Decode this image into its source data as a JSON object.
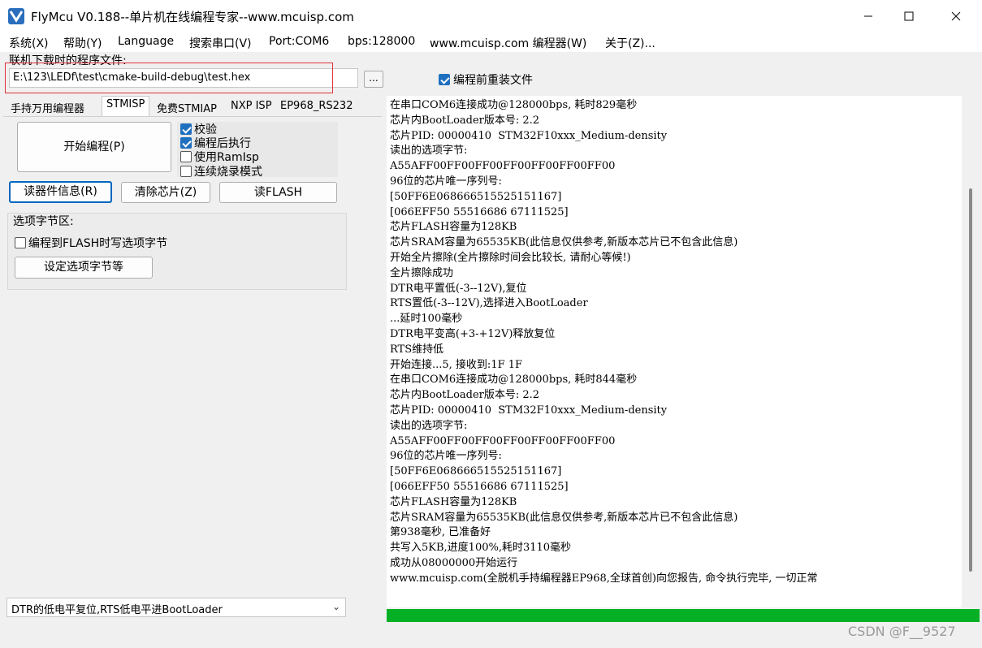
{
  "window": {
    "title": "FlyMcu V0.188--单片机在线编程专家--www.mcuisp.com"
  },
  "menu": [
    "系统(X)",
    "帮助(Y)",
    "Language",
    "搜索串口(V)",
    "Port:COM6",
    "bps:128000",
    "www.mcuisp.com 编程器(W)",
    "关于(Z)..."
  ],
  "file": {
    "label": "联机下载时的程序文件:",
    "path": "E:\\123\\LEDf\\test\\cmake-build-debug\\test.hex",
    "browse_label": "...",
    "reload_label": "编程前重装文件",
    "reload_checked": true
  },
  "tabs": [
    "手持万用编程器",
    "STMISP",
    "免费STMIAP",
    "NXP ISP",
    "EP968_RS232"
  ],
  "actions": {
    "start": "开始编程(P)",
    "read_info": "读器件信息(R)",
    "erase": "清除芯片(Z)",
    "read_flash": "读FLASH"
  },
  "options": [
    {
      "label": "校验",
      "checked": true
    },
    {
      "label": "编程后执行",
      "checked": true
    },
    {
      "label": "使用RamIsp",
      "checked": false
    },
    {
      "label": "连续烧录模式",
      "checked": false
    }
  ],
  "option_bytes": {
    "title": "选项字节区:",
    "write_label": "编程到FLASH时写选项字节",
    "write_checked": false,
    "set_button": "设定选项字节等"
  },
  "boot_mode": "DTR的低电平复位,RTS低电平进BootLoader",
  "log": [
    "在串口COM6连接成功@128000bps, 耗时829毫秒",
    "芯片内BootLoader版本号: 2.2",
    "芯片PID: 00000410  STM32F10xxx_Medium-density",
    "读出的选项字节:",
    "A55AFF00FF00FF00FF00FF00FF00FF00",
    "96位的芯片唯一序列号:",
    "[50FF6E068666515525151167]",
    "[066EFF50 55516686 67111525]",
    "芯片FLASH容量为128KB",
    "芯片SRAM容量为65535KB(此信息仅供参考,新版本芯片已不包含此信息)",
    "开始全片擦除(全片擦除时间会比较长, 请耐心等候!)",
    "全片擦除成功",
    "DTR电平置低(-3--12V),复位",
    "RTS置低(-3--12V),选择进入BootLoader",
    "...延时100毫秒",
    "DTR电平变高(+3-+12V)释放复位",
    "RTS维持低",
    "开始连接...5, 接收到:1F 1F",
    "在串口COM6连接成功@128000bps, 耗时844毫秒",
    "芯片内BootLoader版本号: 2.2",
    "芯片PID: 00000410  STM32F10xxx_Medium-density",
    "读出的选项字节:",
    "A55AFF00FF00FF00FF00FF00FF00FF00",
    "96位的芯片唯一序列号:",
    "[50FF6E068666515525151167]",
    "[066EFF50 55516686 67111525]",
    "芯片FLASH容量为128KB",
    "芯片SRAM容量为65535KB(此信息仅供参考,新版本芯片已不包含此信息)",
    "第938毫秒, 已准备好",
    "共写入5KB,进度100%,耗时3110毫秒",
    "成功从08000000开始运行",
    "www.mcuisp.com(全脱机手持编程器EP968,全球首创)向您报告, 命令执行完毕, 一切正常"
  ],
  "progress": {
    "percent": 100,
    "color": "#06b025"
  },
  "watermark": "CSDN @F__9527"
}
